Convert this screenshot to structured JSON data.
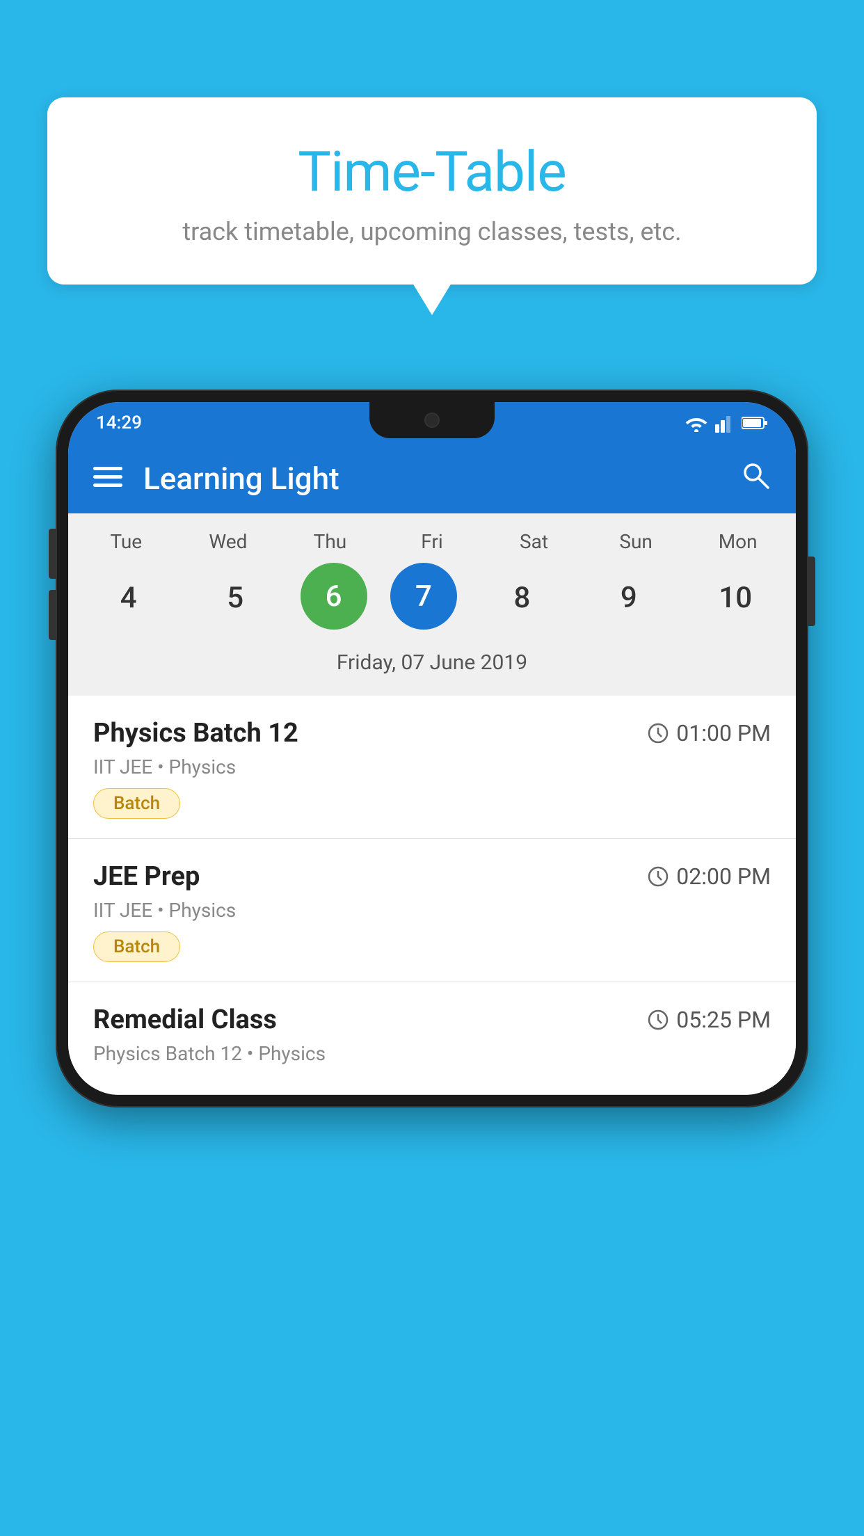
{
  "background_color": "#29b6e8",
  "speech_bubble": {
    "title": "Time-Table",
    "subtitle": "track timetable, upcoming classes, tests, etc."
  },
  "phone": {
    "status_bar": {
      "time": "14:29"
    },
    "app_bar": {
      "title": "Learning Light"
    },
    "calendar": {
      "days": [
        {
          "short": "Tue",
          "num": "4"
        },
        {
          "short": "Wed",
          "num": "5"
        },
        {
          "short": "Thu",
          "num": "6",
          "state": "today"
        },
        {
          "short": "Fri",
          "num": "7",
          "state": "selected"
        },
        {
          "short": "Sat",
          "num": "8"
        },
        {
          "short": "Sun",
          "num": "9"
        },
        {
          "short": "Mon",
          "num": "10"
        }
      ],
      "date_label": "Friday, 07 June 2019"
    },
    "schedule": [
      {
        "name": "Physics Batch 12",
        "time": "01:00 PM",
        "subtitle": "IIT JEE • Physics",
        "badge": "Batch"
      },
      {
        "name": "JEE Prep",
        "time": "02:00 PM",
        "subtitle": "IIT JEE • Physics",
        "badge": "Batch"
      },
      {
        "name": "Remedial Class",
        "time": "05:25 PM",
        "subtitle": "Physics Batch 12 • Physics",
        "badge": ""
      }
    ]
  }
}
